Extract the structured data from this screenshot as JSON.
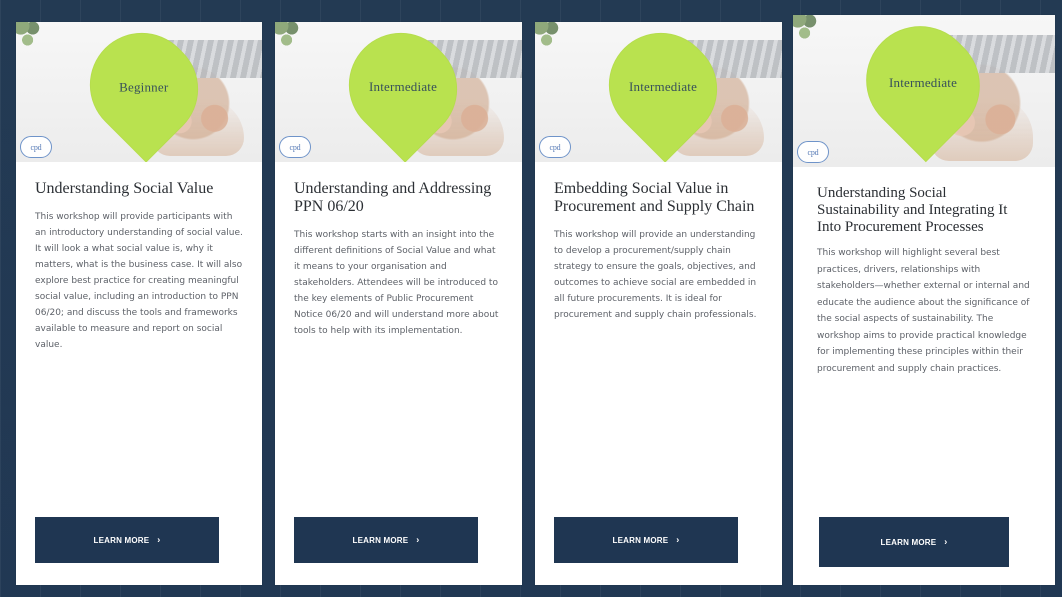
{
  "cards": [
    {
      "level": "Beginner",
      "title": "Understanding Social Value",
      "description": "This workshop will provide participants with an introductory understanding of social value. It will look a what social value is, why it matters, what is the business case. It will also explore best practice for creating meaningful social value, including an introduction to PPN 06/20; and discuss the tools and frameworks available to measure and report on social value.",
      "button": "LEARN MORE",
      "logo": "cpd"
    },
    {
      "level": "Intermediate",
      "title": "Understanding and Addressing PPN 06/20",
      "description": "This workshop starts with an insight into the different definitions of Social Value and what it means to your organisation and stakeholders. Attendees will be introduced to the key elements of Public Procurement Notice 06/20 and will understand more about tools to help with its implementation.",
      "button": "LEARN MORE",
      "logo": "cpd"
    },
    {
      "level": "Intermediate",
      "title": "Embedding Social Value in Procurement and Supply Chain",
      "description": "This workshop will provide an understanding to develop a procurement/supply chain strategy to ensure the goals, objectives, and outcomes to achieve social are embedded in all future procurements. It is ideal for procurement and supply chain professionals.",
      "button": "LEARN MORE",
      "logo": "cpd"
    },
    {
      "level": "Intermediate",
      "title": "Understanding Social Sustainability and Integrating It Into Procurement Processes",
      "description": "This workshop will highlight several best practices, drivers, relationships with stakeholders—whether external or internal and educate the audience about the significance of the social aspects of sustainability. The workshop aims to provide practical knowledge for implementing these principles within their procurement and supply chain practices.",
      "button": "LEARN MORE",
      "logo": "cpd"
    }
  ],
  "icons": {
    "arrow": "chevron-right-icon",
    "logo": "cpd-logo-icon"
  },
  "colors": {
    "background": "#223a56",
    "card": "#ffffff",
    "badge": "#b9e24f",
    "button": "#1f3652",
    "title": "#2b2f34",
    "body": "#5d6168"
  }
}
